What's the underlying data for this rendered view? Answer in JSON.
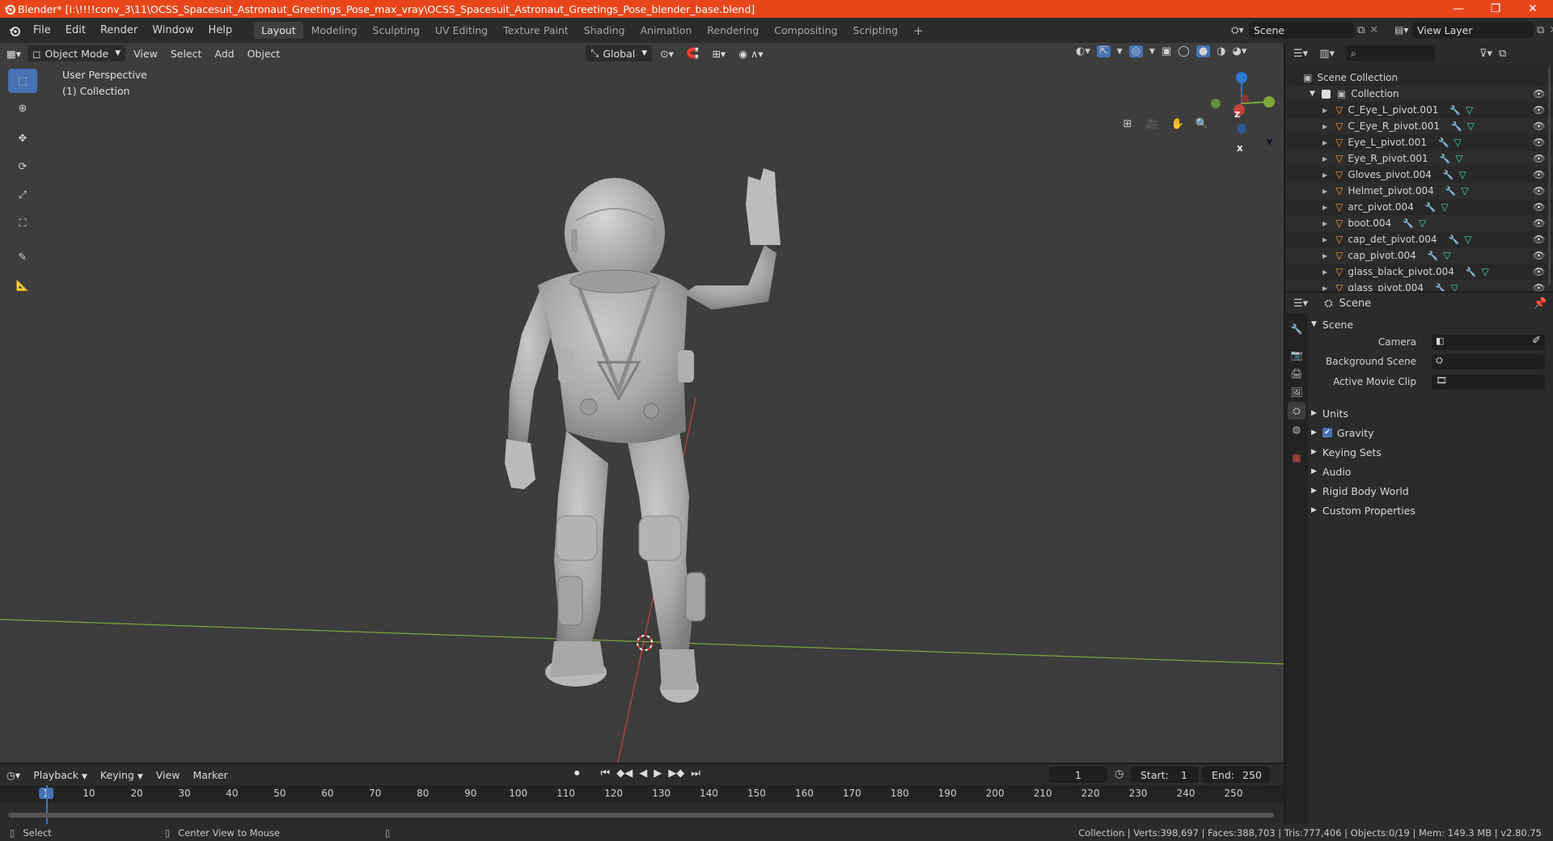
{
  "titlebar": {
    "title": "Blender* [I:\\!!!!conv_3\\11\\OCSS_Spacesuit_Astronaut_Greetings_Pose_max_vray\\OCSS_Spacesuit_Astronaut_Greetings_Pose_blender_base.blend]",
    "controls": [
      "—",
      "❐",
      "✕"
    ]
  },
  "menubar": {
    "menus": [
      "File",
      "Edit",
      "Render",
      "Window",
      "Help"
    ],
    "workspaces": [
      "Layout",
      "Modeling",
      "Sculpting",
      "UV Editing",
      "Texture Paint",
      "Shading",
      "Animation",
      "Rendering",
      "Compositing",
      "Scripting"
    ],
    "active_workspace": "Layout",
    "scene_name": "Scene",
    "view_layer": "View Layer"
  },
  "viewport": {
    "mode": "Object Mode",
    "menus": [
      "View",
      "Select",
      "Add",
      "Object"
    ],
    "orientation": "Global",
    "perspective_label": "User Perspective",
    "collection_label": "(1) Collection",
    "gizmo_axes": {
      "x": "X",
      "y": "Y",
      "z": "Z"
    },
    "colors": {
      "background": "#3d3d3d",
      "x_axis": "#c8423f",
      "y_axis": "#7ea83a",
      "active_tool": "#4772b3"
    }
  },
  "outliner": {
    "root": "Scene Collection",
    "collection": "Collection",
    "items": [
      "C_Eye_L_pivot.001",
      "C_Eye_R_pivot.001",
      "Eye_L_pivot.001",
      "Eye_R_pivot.001",
      "Gloves_pivot.004",
      "Helmet_pivot.004",
      "arc_pivot.004",
      "boot.004",
      "cap_det_pivot.004",
      "cap_pivot.004",
      "glass_black_pivot.004",
      "glass_pivot.004"
    ]
  },
  "properties": {
    "context_label": "Scene",
    "panel_title": "Scene",
    "fields": [
      {
        "label": "Camera"
      },
      {
        "label": "Background Scene"
      },
      {
        "label": "Active Movie Clip"
      }
    ],
    "subpanels": [
      "Units",
      "Gravity",
      "Keying Sets",
      "Audio",
      "Rigid Body World",
      "Custom Properties"
    ],
    "gravity_checked": true
  },
  "timeline": {
    "menus": [
      "Playback",
      "Keying",
      "View",
      "Marker"
    ],
    "current_frame": "1",
    "start_label": "Start:",
    "start": "1",
    "end_label": "End:",
    "end": "250",
    "ruler_ticks": [
      "1",
      "10",
      "20",
      "30",
      "40",
      "50",
      "60",
      "70",
      "80",
      "90",
      "100",
      "110",
      "120",
      "130",
      "140",
      "150",
      "160",
      "170",
      "180",
      "190",
      "200",
      "210",
      "220",
      "230",
      "240",
      "250"
    ]
  },
  "statusbar": {
    "left_action": "Select",
    "middle_action": "Center View to Mouse",
    "stats": "Collection | Verts:398,697 | Faces:388,703 | Tris:777,406 | Objects:0/19 | Mem: 149.3 MB | v2.80.75"
  }
}
